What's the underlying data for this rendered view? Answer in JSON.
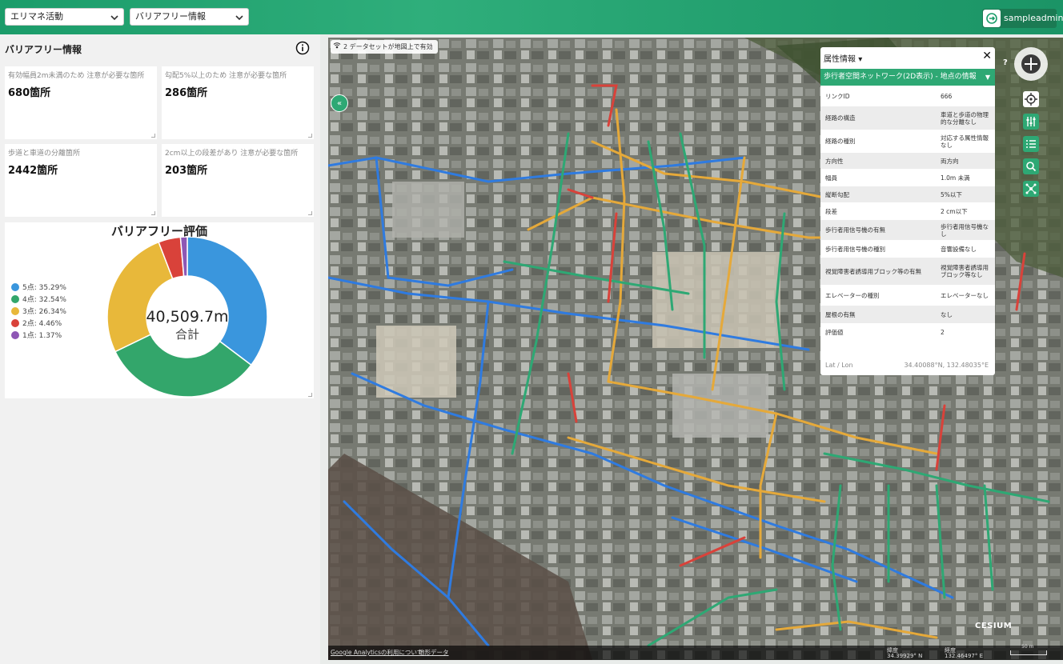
{
  "header": {
    "select1": "エリマネ活動",
    "select2": "バリアフリー情報",
    "user": "sampleadmin"
  },
  "panel": {
    "title": "バリアフリー情報",
    "cards": [
      {
        "label": "有効幅員2m未満のため 注意が必要な箇所",
        "value": "680箇所"
      },
      {
        "label": "勾配5%以上のため 注意が必要な箇所",
        "value": "286箇所"
      },
      {
        "label": "歩道と車道の分離箇所",
        "value": "2442箇所"
      },
      {
        "label": "2cm以上の段差があり 注意が必要な箇所",
        "value": "203箇所"
      }
    ]
  },
  "chart_data": {
    "type": "pie",
    "title": "バリアフリー評価",
    "categories": [
      "5点",
      "4点",
      "3点",
      "2点",
      "1点"
    ],
    "values": [
      35.29,
      32.54,
      26.34,
      4.46,
      1.37
    ],
    "legend_labels": [
      "5点: 35.29%",
      "4点: 32.54%",
      "3点: 26.34%",
      "2点: 4.46%",
      "1点: 1.37%"
    ],
    "colors": [
      "#3a96dd",
      "#33a66b",
      "#e8b83a",
      "#d9423a",
      "#8e57b5"
    ],
    "center_value": "40,509.7m",
    "center_label": "合計",
    "legend": "left"
  },
  "map": {
    "dataset_badge": "2 データセットが地図上で有効",
    "foot_link1": "Google Analyticsの利用について",
    "foot_link2": "地形データ",
    "lat_label": "緯度",
    "lat_value": "34.39929° N",
    "lon_label": "経度",
    "lon_value": "132.46497° E",
    "scale": "50 m",
    "cesium": "CESIUM"
  },
  "attr": {
    "header": "属性情報",
    "layer": "歩行者空間ネットワーク(2D表示) - 地点の情報",
    "rows": [
      {
        "k": "リンクID",
        "v": "666"
      },
      {
        "k": "経路の構造",
        "v": "車道と歩道の物理的な分離なし"
      },
      {
        "k": "経路の種別",
        "v": "対応する属性情報なし"
      },
      {
        "k": "方向性",
        "v": "両方向"
      },
      {
        "k": "幅員",
        "v": "1.0m 未満"
      },
      {
        "k": "縦断勾配",
        "v": "5%以下"
      },
      {
        "k": "段差",
        "v": "2 cm以下"
      },
      {
        "k": "歩行者用信号機の有無",
        "v": "歩行者用信号機なし"
      },
      {
        "k": "歩行者用信号機の種別",
        "v": "音響設備なし"
      },
      {
        "k": "視覚障害者誘導用ブロック等の有無",
        "v": "視覚障害者誘導用ブロック等なし"
      },
      {
        "k": "エレベーターの種別",
        "v": "エレベーターなし"
      },
      {
        "k": "屋根の有無",
        "v": "なし"
      },
      {
        "k": "評価値",
        "v": "2"
      }
    ],
    "latlon_label": "Lat / Lon",
    "latlon_value": "34.40088°N, 132.48035°E"
  }
}
